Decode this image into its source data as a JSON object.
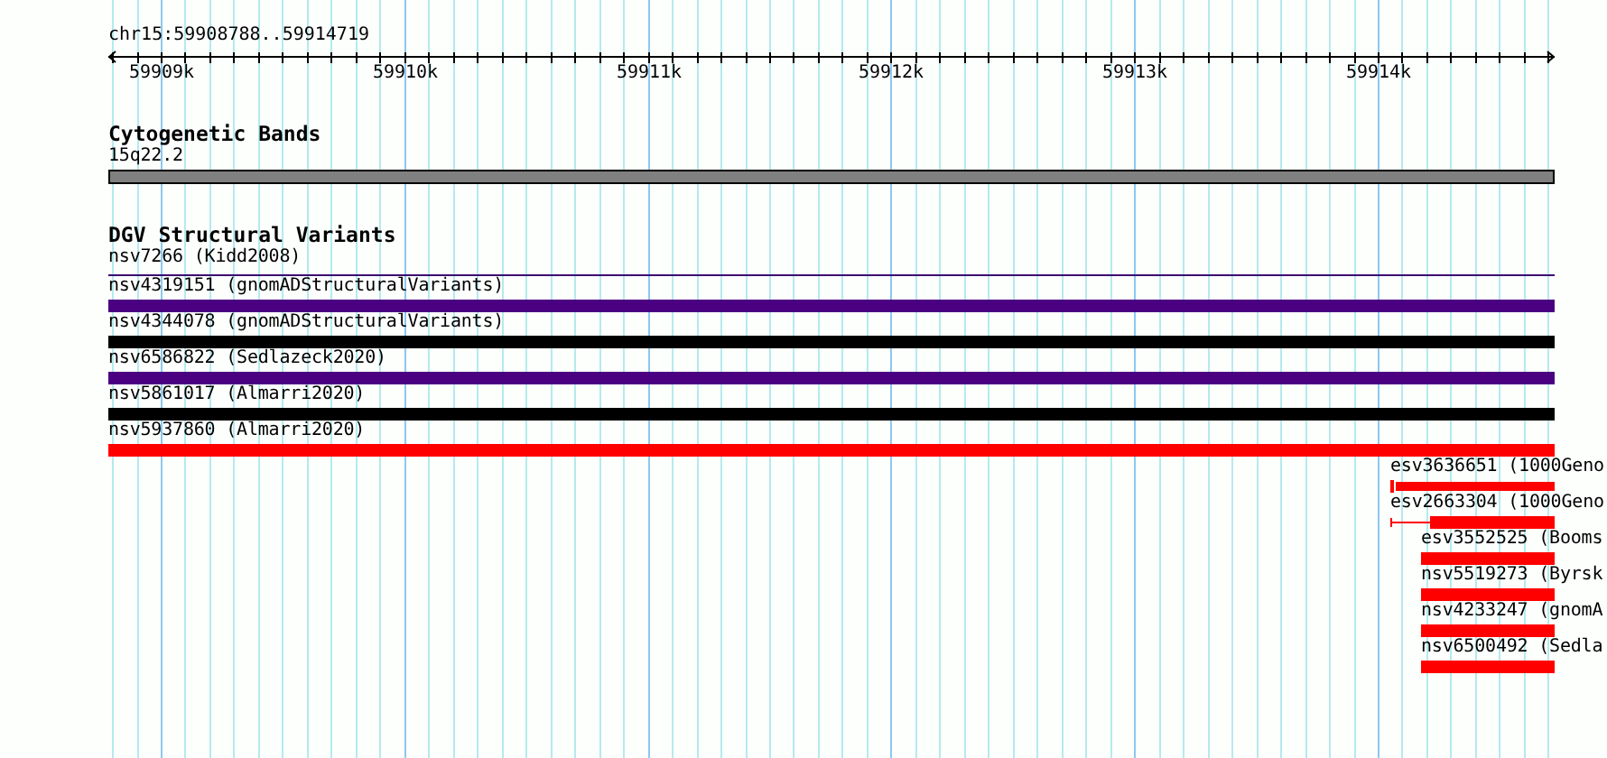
{
  "ruler": {
    "location": "chr15:59908788..59914719",
    "ticks": [
      "59909k",
      "59910k",
      "59911k",
      "59912k",
      "59913k",
      "59914k"
    ]
  },
  "tracks": [
    {
      "kind": "bands",
      "title": "Cytogenetic Bands",
      "features": [
        {
          "label": "15q22.2",
          "kind": "band",
          "color": "#808080"
        }
      ]
    },
    {
      "kind": "variants",
      "title": "DGV Structural Variants",
      "features": [
        {
          "label": "nsv7266 (Kidd2008)",
          "kind": "line",
          "color": "#3a0870"
        },
        {
          "label": "nsv4319151 (gnomADStructuralVariants)",
          "kind": "bar",
          "color": "#4b0082"
        },
        {
          "label": "nsv4344078 (gnomADStructuralVariants)",
          "kind": "bar",
          "color": "#000000"
        },
        {
          "label": "nsv6586822 (Sedlazeck2020)",
          "kind": "bar",
          "color": "#4b0082"
        },
        {
          "label": "nsv5861017 (Almarri2020)",
          "kind": "bar",
          "color": "#000000"
        },
        {
          "label": "nsv5937860 (Almarri2020)",
          "kind": "bar",
          "color": "#ff0000"
        },
        {
          "label": "esv3636651 (1000Geno",
          "kind": "tick-bar",
          "color": "#ff0000"
        },
        {
          "label": "esv2663304 (1000Geno",
          "kind": "split",
          "color": "#ff0000"
        },
        {
          "label": "esv3552525 (Booms",
          "kind": "bar",
          "color": "#ff0000"
        },
        {
          "label": "nsv5519273 (Byrsk",
          "kind": "bar",
          "color": "#ff0000"
        },
        {
          "label": "nsv4233247 (gnomA",
          "kind": "bar",
          "color": "#ff0000"
        },
        {
          "label": "nsv6500492 (Sedla",
          "kind": "bar",
          "color": "#ff0000"
        }
      ]
    }
  ]
}
